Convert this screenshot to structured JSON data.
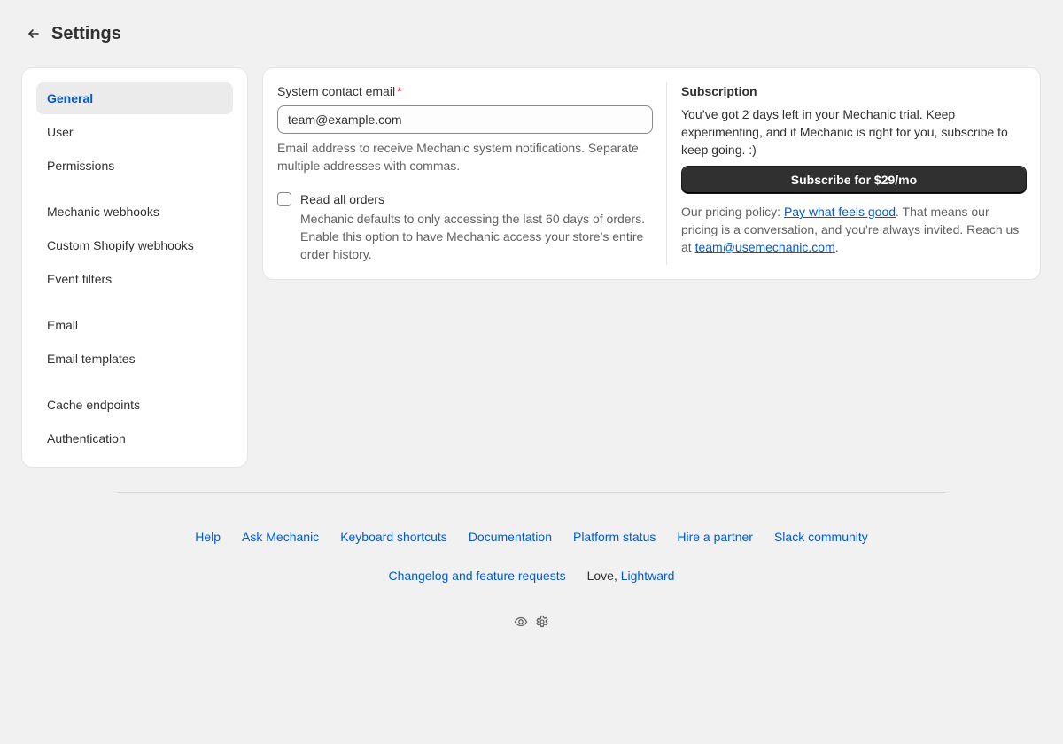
{
  "header": {
    "title": "Settings",
    "back_icon": "arrow-left-icon"
  },
  "sidebar": {
    "groups": [
      [
        "General",
        "User",
        "Permissions"
      ],
      [
        "Mechanic webhooks",
        "Custom Shopify webhooks",
        "Event filters"
      ],
      [
        "Email",
        "Email templates"
      ],
      [
        "Cache endpoints",
        "Authentication"
      ]
    ],
    "active": "General"
  },
  "general": {
    "email_label": "System contact email",
    "required_mark": "*",
    "email_value": "team@example.com",
    "email_help": "Email address to receive Mechanic system notifications. Separate multiple addresses with commas.",
    "checkbox_label": "Read all orders",
    "checkbox_checked": false,
    "checkbox_help": "Mechanic defaults to only accessing the last 60 days of orders. Enable this option to have Mechanic access your store’s entire order history."
  },
  "subscription": {
    "title": "Subscription",
    "trial_text": "You’ve got 2 days left in your Mechanic trial. Keep experimenting, and if Mechanic is right for you, subscribe to keep going. :)",
    "button_label": "Subscribe for $29/mo",
    "policy_prefix": "Our pricing policy: ",
    "policy_link": "Pay what feels good",
    "policy_middle": ". That means our pricing is a conversation, and you’re always invited. Reach us at ",
    "email_link": "team@usemechanic.com",
    "policy_suffix": "."
  },
  "footer": {
    "row1": [
      "Help",
      "Ask Mechanic",
      "Keyboard shortcuts",
      "Documentation",
      "Platform status",
      "Hire a partner",
      "Slack community"
    ],
    "changelog": "Changelog and feature requests",
    "love_prefix": "Love, ",
    "love_link": "Lightward",
    "icons": [
      "eye-icon",
      "gear-icon"
    ]
  },
  "colors": {
    "accent": "#005bd3",
    "background": "#f1f1f1",
    "button": "#303030"
  }
}
